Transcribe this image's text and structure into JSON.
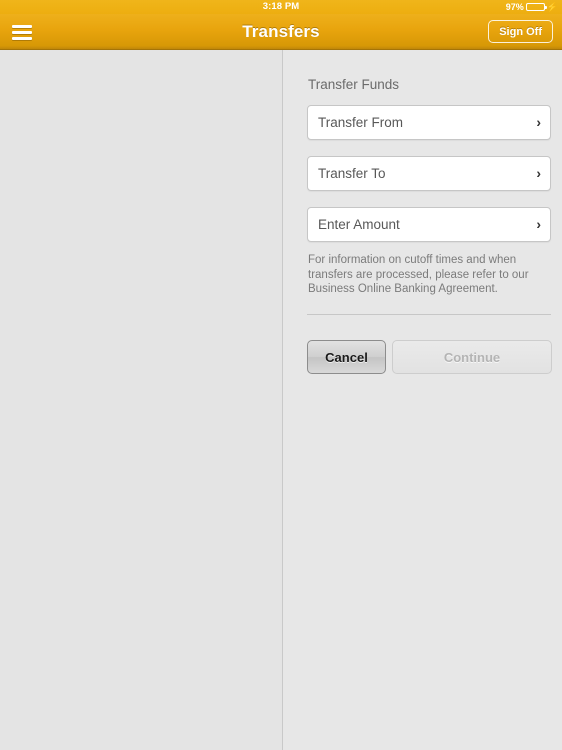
{
  "status_bar": {
    "time": "3:18 PM",
    "battery_percent": "97%",
    "battery_level": 97,
    "charging_glyph": "⚡",
    "battery_color": "#4cd964"
  },
  "nav_bar": {
    "title": "Transfers",
    "menu_icon": "hamburger-menu-icon",
    "sign_off_label": "Sign Off",
    "accent_color": "#e8a40d"
  },
  "form": {
    "section_title": "Transfer Funds",
    "fields": [
      {
        "label": "Transfer From",
        "value": "",
        "chevron": "›"
      },
      {
        "label": "Transfer To",
        "value": "",
        "chevron": "›"
      },
      {
        "label": "Enter Amount",
        "value": "",
        "chevron": "›"
      }
    ],
    "disclaimer": "For information on cutoff times and when transfers are processed, please refer to our Business Online Banking Agreement.",
    "buttons": {
      "cancel_label": "Cancel",
      "continue_label": "Continue",
      "continue_disabled": true
    }
  }
}
